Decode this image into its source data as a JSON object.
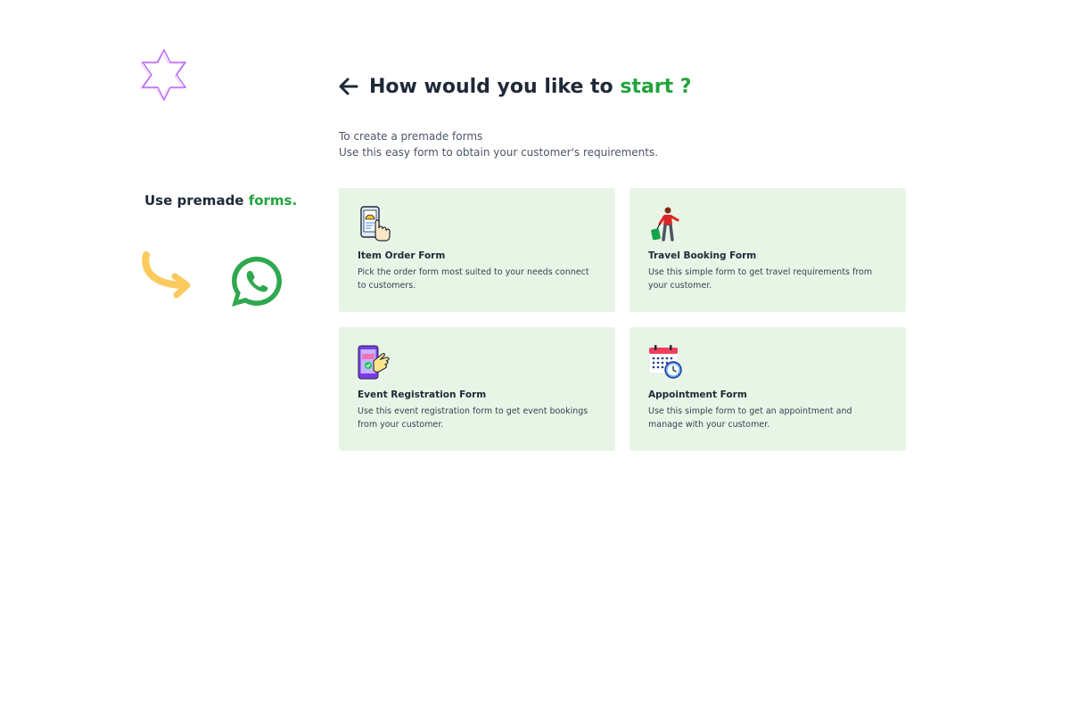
{
  "sidebar": {
    "tagline_prefix": "Use premade ",
    "tagline_accent": "forms."
  },
  "header": {
    "title_prefix": "How would you like to ",
    "title_accent": "start ?"
  },
  "subtitle": {
    "line1": "To create a premade forms",
    "line2": "Use this easy form to obtain your customer's requirements."
  },
  "cards": [
    {
      "icon": "phone-order-icon",
      "title": "Item Order Form",
      "description": "Pick the order form most suited to your needs connect to customers."
    },
    {
      "icon": "traveler-icon",
      "title": "Travel Booking Form",
      "description": "Use this simple form to get travel requirements from your customer."
    },
    {
      "icon": "ticket-phone-icon",
      "title": "Event Registration Form",
      "description": "Use this event registration form to get event bookings from your customer."
    },
    {
      "icon": "calendar-clock-icon",
      "title": "Appointment Form",
      "description": "Use this simple form to get an appointment and manage with your customer."
    }
  ],
  "colors": {
    "accent": "#22a33c",
    "card_bg": "#e8f5e6",
    "text": "#1f2937",
    "whatsapp": "#2fa84f",
    "star": "#a855f7",
    "arrow": "#fcc95c"
  }
}
